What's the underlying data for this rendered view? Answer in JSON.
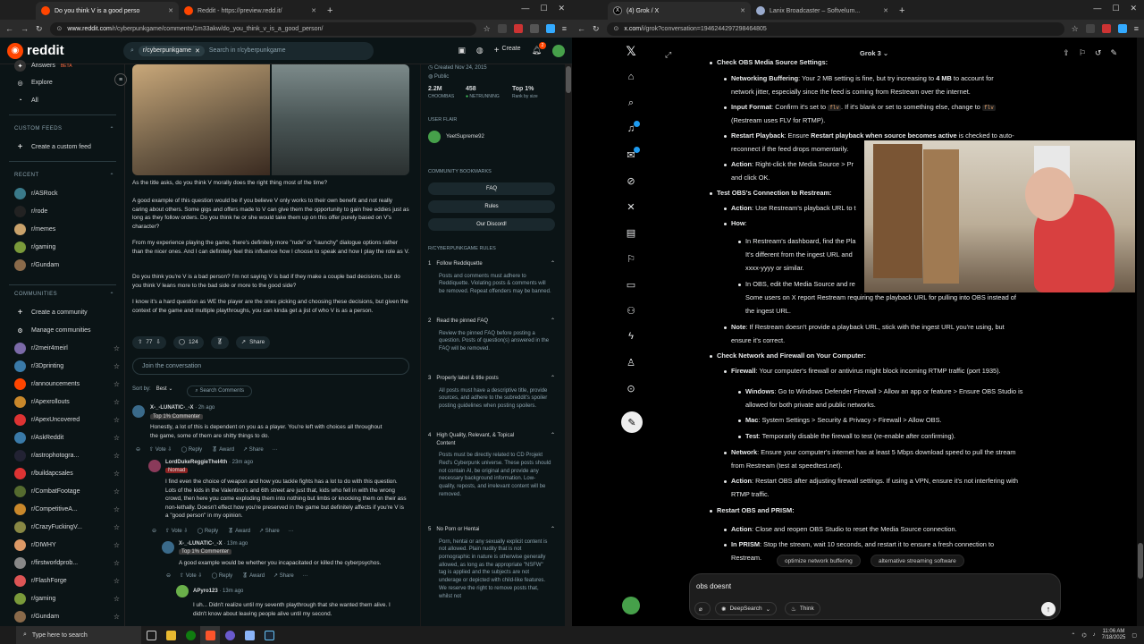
{
  "left_browser": {
    "tabs": [
      {
        "title": "Do you think V is a good perso",
        "active": true
      },
      {
        "title": "Reddit - https://preview.redd.it/",
        "active": false
      }
    ],
    "url_prefix": "www.reddit.com",
    "url_path": "/r/cyberpunkgame/comments/1m33akw/do_you_think_v_is_a_good_person/"
  },
  "reddit": {
    "logo": "reddit",
    "search_chip": "r/cyberpunkgame",
    "search_placeholder": "Search in r/cyberpunkgame",
    "create_label": "Create",
    "notif_count": "2",
    "sidebar": {
      "answers_label": "Answers",
      "answers_beta": "BETA",
      "explore": "Explore",
      "all": "All",
      "custom_feeds_header": "CUSTOM FEEDS",
      "create_custom_feed": "Create a custom feed",
      "recent_header": "RECENT",
      "recent": [
        {
          "name": "r/ASRock",
          "color": "#3a7a8a"
        },
        {
          "name": "r/rode",
          "color": "#222"
        },
        {
          "name": "r/memes",
          "color": "#c9a26b"
        },
        {
          "name": "r/gaming",
          "color": "#7a9a3a"
        },
        {
          "name": "r/Gundam",
          "color": "#8a6a4a"
        }
      ],
      "communities_header": "COMMUNITIES",
      "create_community": "Create a community",
      "manage_communities": "Manage communities",
      "communities": [
        {
          "name": "r/2meir4meirl",
          "color": "#7b6aa8"
        },
        {
          "name": "r/3Dprinting",
          "color": "#3a7aa8"
        },
        {
          "name": "r/announcements",
          "color": "#ff4500"
        },
        {
          "name": "r/Apexrollouts",
          "color": "#c9882b"
        },
        {
          "name": "r/ApexUncovered",
          "color": "#d33"
        },
        {
          "name": "r/AskReddit",
          "color": "#3a7aa8"
        },
        {
          "name": "r/astrophotogra...",
          "color": "#223"
        },
        {
          "name": "r/buildapcsales",
          "color": "#d33"
        },
        {
          "name": "r/CombatFootage",
          "color": "#556b2f"
        },
        {
          "name": "r/CompetitiveA...",
          "color": "#c9882b"
        },
        {
          "name": "r/CrazyFuckingV...",
          "color": "#884"
        },
        {
          "name": "r/DIWHY",
          "color": "#d96"
        },
        {
          "name": "r/firstworldprob...",
          "color": "#888"
        },
        {
          "name": "r/FlashForge",
          "color": "#d55"
        },
        {
          "name": "r/gaming",
          "color": "#7a9a3a"
        },
        {
          "name": "r/Gundam",
          "color": "#8a6a4a"
        }
      ]
    },
    "post": {
      "para1": "As the title asks, do you think V morally does the right thing most of the time?",
      "para2": "A good example of this question would be if you believe V only works to their own benefit and not really caring about others. Some gigs and offers made to V can give them the opportunity to gain free eddies just as long as they follow orders. Do you think he or she would take them up on this offer purely based on V's character?",
      "para3": "From my experience playing the game, there's definitely more \"rude\" or \"raunchy\" dialogue options rather than the nicer ones. And I can definitely feel this influence how I choose to speak and how I play the role as V.",
      "para4": "Do you think you're V is a bad person? I'm not saying V is bad if they make a couple bad decisions, but do you think V leans more to the bad side or more to the good side?",
      "para5": "I know it's a hard question as WE the player are the ones picking and choosing these decisions, but given the context of the game and multiple playthroughs, you can kinda get a jist of who V is as a person.",
      "votes": "77",
      "comments": "124",
      "share": "Share",
      "join_placeholder": "Join the conversation",
      "sort_label": "Sort by:",
      "sort_value": "Best",
      "search_comments": "Search Comments"
    },
    "comments": [
      {
        "author": "X-_-LUNATIC-_-X",
        "time": "· 2h ago",
        "flair": "Top 1% Commenter",
        "text": "Honestly, a lot of this is dependent on you as a player. You're left with choices all throughout the game, some of them are shitty things to do."
      },
      {
        "author": "LordDukeReggieTheI4th",
        "time": "· 23m ago",
        "flair": "Nomad",
        "text": "I find even the choice of weapon and how you tackle fights has a lot to do with this question. Lots of the kids in the Valentino's and 6th street are just that, kids who fell in with the wrong crowd, then here you come exploding them into nothing but limbs or knocking them on their ass non-lethally. Doesn't effect how you're preserved in the game but definitely affects if you're V is a \"good person\" in my opinion."
      },
      {
        "author": "X-_-LUNATIC-_-X",
        "time": "· 13m ago",
        "flair": "Top 1% Commenter",
        "text": "A good example would be whether you incapacitated or killed the cyberpsychos."
      },
      {
        "author": "APyro123",
        "time": "· 13m ago",
        "flair": "",
        "text": "I uh... Didn't realize until my seventh playthrough that she wanted them alive. I didn't know about leaving people alive until my second."
      }
    ],
    "comment_actions": {
      "vote": "Vote",
      "reply": "Reply",
      "award": "Award",
      "share": "Share"
    },
    "right": {
      "created": "Created Nov 24, 2015",
      "public": "Public",
      "stats": [
        {
          "value": "2.2M",
          "label": "CHOOMBAS"
        },
        {
          "value": "458",
          "label": "NETRUNNING"
        },
        {
          "value": "Top 1%",
          "label": "Rank by size"
        }
      ],
      "user_flair_header": "USER FLAIR",
      "user_flair": "YeetSupreme92",
      "bookmarks_header": "COMMUNITY BOOKMARKS",
      "bookmarks": [
        "FAQ",
        "Rules",
        "Our Discord!"
      ],
      "rules_header": "R/CYBERPUNKGAME RULES",
      "rules": [
        {
          "n": "1",
          "title": "Follow Reddiquette",
          "body": "Posts and comments must adhere to Reddiquette. Violating posts & comments will be removed. Repeat offenders may be banned."
        },
        {
          "n": "2",
          "title": "Read the pinned FAQ",
          "body": "Review the pinned FAQ before posting a question. Posts of question(s) answered in the FAQ will be removed."
        },
        {
          "n": "3",
          "title": "Properly label & title posts",
          "body": "All posts must have a descriptive title, provide sources, and adhere to the subreddit's spoiler posting guidelines when posting spoilers."
        },
        {
          "n": "4",
          "title": "High Quality, Relevant, & Topical Content",
          "body": "Posts must be directly related to CD Projekt Red's Cyberpunk universe. These posts should not contain AI, be original and provide any necessary background information. Low-quality, reposts, and irrelevant content will be removed."
        },
        {
          "n": "5",
          "title": "No Porn or Hentai",
          "body": "Porn, hentai or any sexually explicit content is not allowed. Plain nudity that is not pornographic in nature is otherwise generally allowed, as long as the appropriate \"NSFW\" tag is applied and the subjects are not underage or depicted with child-like features. We reserve the right to remove posts that, whilst not"
        }
      ]
    }
  },
  "right_browser": {
    "tabs": [
      {
        "title": "(4) Grok / X",
        "active": true
      },
      {
        "title": "Lanix Broadcaster – Softvelum...",
        "active": false
      }
    ],
    "url_prefix": "x.com",
    "url_path": "/i/grok?conversation=1946244297298464805"
  },
  "grok": {
    "title": "Grok 3",
    "lines": [
      {
        "type": "h",
        "text": "Check OBS Media Source Settings:"
      },
      {
        "type": "b",
        "label": "Networking Buffering",
        "text": ": Your 2 MB setting is fine, but try increasing to ",
        "bold2": "4 MB",
        "text2": " to account for"
      },
      {
        "type": "c",
        "text": "network jitter, especially since the feed is coming from Restream over the internet."
      },
      {
        "type": "b",
        "label": "Input Format",
        "text": ": Confirm it's set to ",
        "code": "flv",
        ".text2": "",
        "text2": ". If it's blank or set to something else, change to ",
        "code2": "flv"
      },
      {
        "type": "c",
        "text": "(Restream uses FLV for RTMP)."
      },
      {
        "type": "b",
        "label": "Restart Playback",
        "text": ": Ensure ",
        "bold2": "Restart playback when source becomes active",
        "text2": " is checked to auto-"
      },
      {
        "type": "c",
        "text": "reconnect if the feed drops momentarily."
      },
      {
        "type": "b",
        "label": "Action",
        "text": ": Right-click the Media Source > Pr",
        "text2": ""
      },
      {
        "type": "c",
        "text": "and click OK."
      },
      {
        "type": "h",
        "text": "Test OBS's Connection to Restream:"
      },
      {
        "type": "b",
        "label": "Action",
        "text": ": Use Restream's playback URL to t",
        "text2": ""
      },
      {
        "type": "b",
        "label": "How",
        "text": ":",
        "text2": ""
      },
      {
        "type": "s",
        "text": "In Restream's dashboard, find the Pla"
      },
      {
        "type": "c2",
        "text": "It's different from the ingest URL and"
      },
      {
        "type": "c2",
        "text": "xxxx-yyyy or similar."
      },
      {
        "type": "s",
        "text": "In OBS, edit the Media Source and re"
      },
      {
        "type": "c2",
        "text": "Some users on X report Restream requiring the playback URL for pulling into OBS instead of"
      },
      {
        "type": "c2",
        "text": "the ingest URL."
      },
      {
        "type": "b",
        "label": "Note",
        "text": ": If Restream doesn't provide a playback URL, stick with the ingest URL you're using, but",
        "text2": ""
      },
      {
        "type": "c",
        "text": "ensure it's correct."
      },
      {
        "type": "h",
        "text": "Check Network and Firewall on Your Computer:"
      },
      {
        "type": "b",
        "label": "Firewall",
        "text": ": Your computer's firewall or antivirus might block incoming RTMP traffic (port 1935).",
        "text2": ""
      },
      {
        "type": "s",
        "label": "Windows",
        "text": ": Go to Windows Defender Firewall > Allow an app or feature > Ensure OBS Studio is"
      },
      {
        "type": "c2",
        "text": "allowed for both private and public networks."
      },
      {
        "type": "s",
        "label": "Mac",
        "text": ": System Settings > Security & Privacy > Firewall > Allow OBS."
      },
      {
        "type": "s",
        "label": "Test",
        "text": ": Temporarily disable the firewall to test (re-enable after confirming)."
      },
      {
        "type": "b",
        "label": "Network",
        "text": ": Ensure your computer's internet has at least 5 Mbps download speed to pull the stream",
        "text2": ""
      },
      {
        "type": "c",
        "text": "from Restream (test at speedtest.net)."
      },
      {
        "type": "b",
        "label": "Action",
        "text": ": Restart OBS after adjusting firewall settings. If using a VPN, ensure it's not interfering with",
        "text2": ""
      },
      {
        "type": "c",
        "text": "RTMP traffic."
      },
      {
        "type": "h",
        "text": "Restart OBS and PRISM:"
      },
      {
        "type": "b",
        "label": "Action",
        "text": ": Close and reopen OBS Studio to reset the Media Source connection.",
        "text2": ""
      },
      {
        "type": "b",
        "label": "In PRISM",
        "text": ": Stop the stream, wait 10 seconds, and restart it to ensure a fresh connection to",
        "text2": ""
      },
      {
        "type": "c",
        "text": "Restream."
      }
    ],
    "suggestions": [
      "optimize network buffering",
      "alternative streaming software"
    ],
    "input_value": "obs doesnt",
    "deepsearch": "DeepSearch",
    "think": "Think"
  },
  "taskbar": {
    "search_placeholder": "Type here to search",
    "time": "11:06 AM",
    "date": "7/18/2025"
  }
}
